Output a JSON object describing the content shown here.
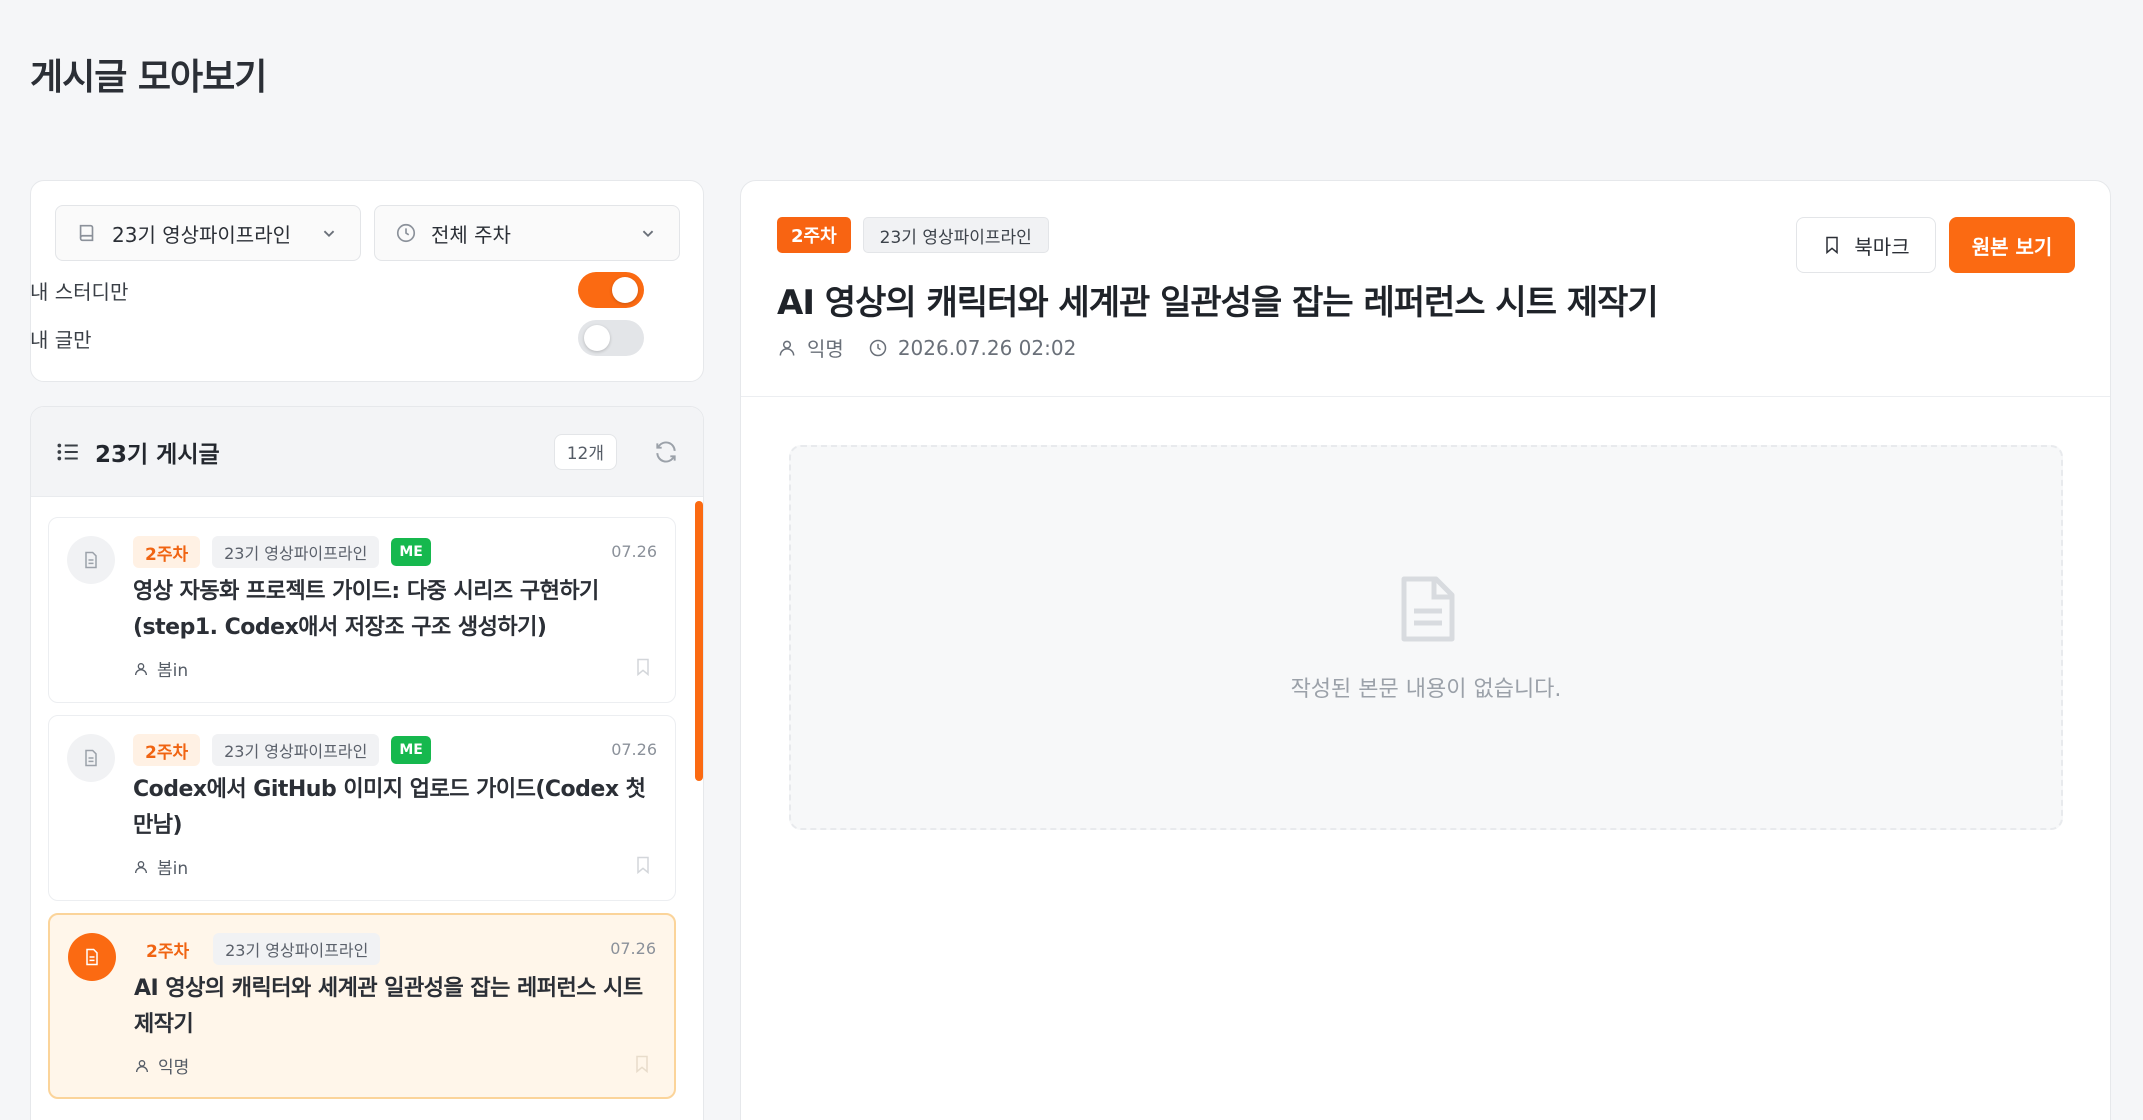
{
  "page": {
    "title": "게시글 모아보기"
  },
  "filters": {
    "cohort_select": {
      "value": "23기 영상파이프라인",
      "icon": "book-icon"
    },
    "week_select": {
      "value": "전체 주차",
      "icon": "clock-icon"
    },
    "toggles": [
      {
        "label": "내 스터디만",
        "on": true
      },
      {
        "label": "내 글만",
        "on": false
      }
    ]
  },
  "list": {
    "title": "23기 게시글",
    "count": "12개",
    "posts": [
      {
        "week": "2주차",
        "cohort": "23기 영상파이프라인",
        "me_badge": "ME",
        "date": "07.26",
        "title": "영상 자동화 프로젝트 가이드: 다중 시리즈 구현하기(step1. Codex애서 저장조 구조 생성하기)",
        "author": "봄in",
        "active": false
      },
      {
        "week": "2주차",
        "cohort": "23기 영상파이프라인",
        "me_badge": "ME",
        "date": "07.26",
        "title": "Codex에서 GitHub 이미지 업로드 가이드(Codex 첫 만남)",
        "author": "봄in",
        "active": false
      },
      {
        "week": "2주차",
        "cohort": "23기 영상파이프라인",
        "me_badge": "",
        "date": "07.26",
        "title": "AI 영상의 캐릭터와 세계관 일관성을 잡는 레퍼런스 시트 제작기",
        "author": "익명",
        "active": true
      }
    ]
  },
  "detail": {
    "week": "2주차",
    "cohort": "23기 영상파이프라인",
    "title": "AI 영상의 캐릭터와 세계관 일관성을 잡는 레퍼런스 시트 제작기",
    "author": "익명",
    "datetime": "2026.07.26 02:02",
    "bookmark_label": "북마크",
    "original_label": "원본 보기",
    "empty_text": "작성된 본문 내용이 없습니다."
  },
  "colors": {
    "accent": "#fb6a12",
    "me_badge": "#16b84e",
    "active_card_bg": "#fff6ea"
  }
}
